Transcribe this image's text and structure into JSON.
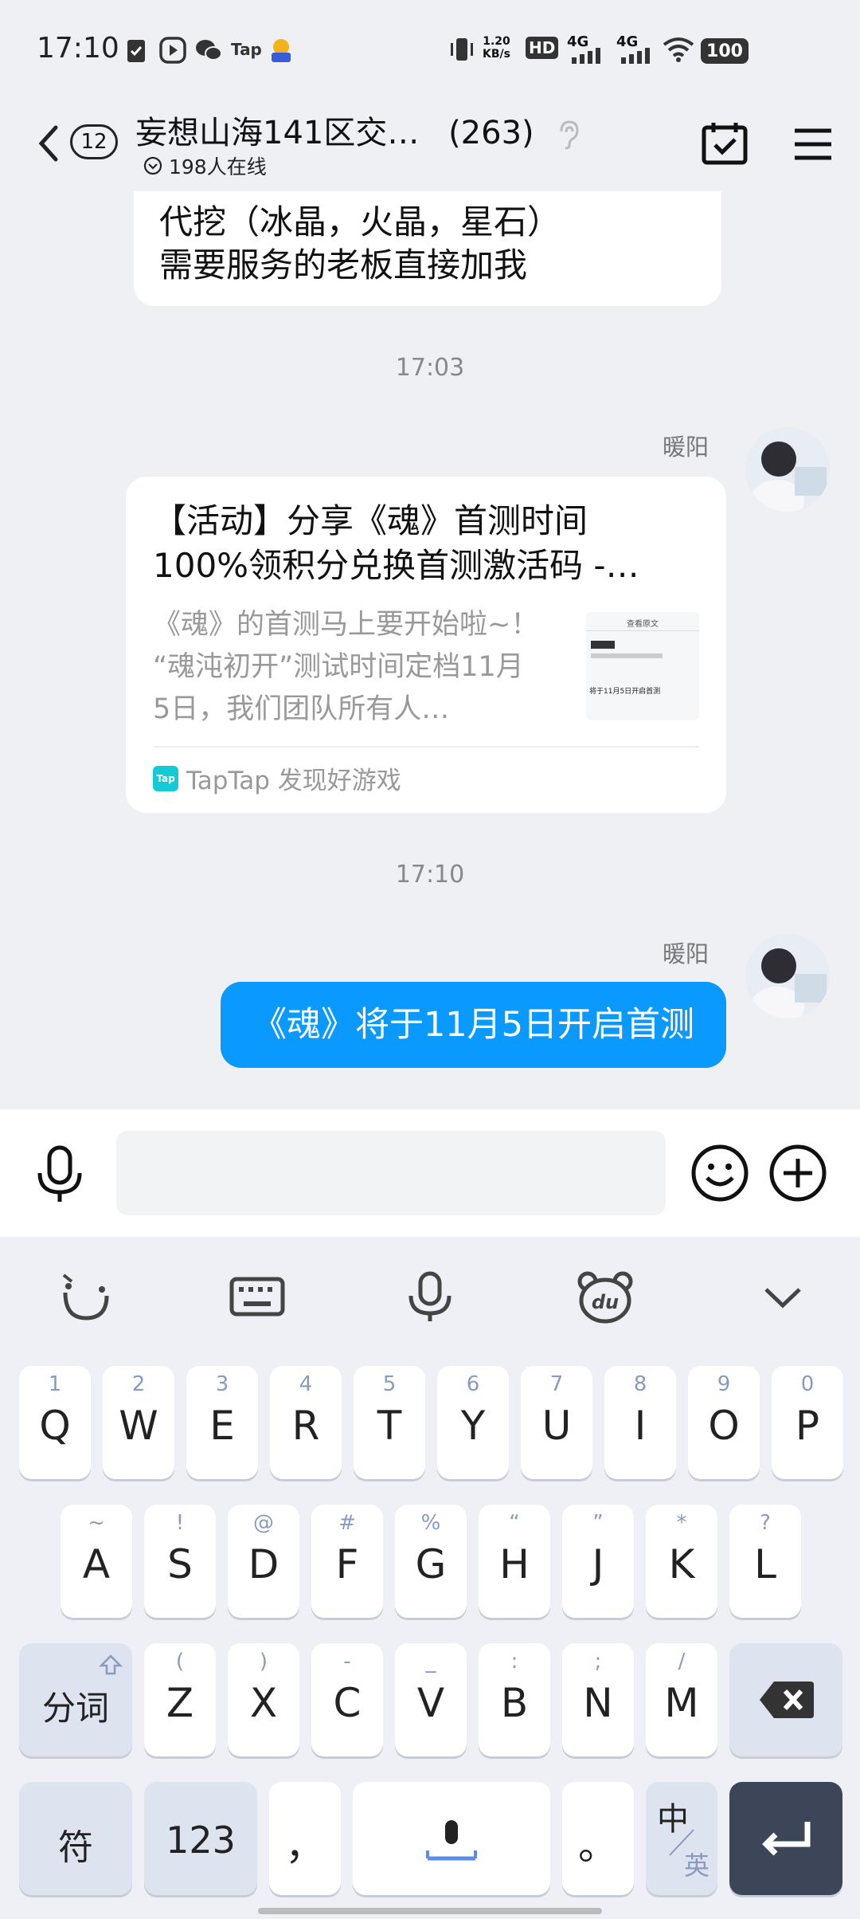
{
  "status_bar": {
    "time": "17:10",
    "net_speed_value": "1.20",
    "net_speed_unit": "KB/s",
    "hd_label": "HD",
    "signal_1": "4G",
    "signal_2": "4G",
    "battery": "100"
  },
  "header": {
    "unread_count": "12",
    "title": "妄想山海141区交…",
    "member_count": "(263)",
    "online": "198人在线"
  },
  "messages": [
    {
      "text_lines": [
        "代挖（冰晶，火晶，星石）",
        "需要服务的老板直接加我"
      ]
    },
    {
      "timestamp": "17:03",
      "sender": "暖阳",
      "card": {
        "title_line1": "【活动】分享《魂》首测时间",
        "title_line2": "100%领积分兑换首测激活码 -…",
        "desc_line1": "《魂》的首测马上要开始啦~！",
        "desc_line2": "“魂沌初开”测试时间定档11月",
        "desc_line3": "5日，我们团队所有人…",
        "thumb_header": "查看原文",
        "thumb_link": "将于11月5日开启首测",
        "source_logo": "Tap",
        "source": "TapTap 发现好游戏"
      }
    },
    {
      "timestamp": "17:10",
      "sender": "暖阳",
      "text": "《魂》将于11月5日开启首测"
    }
  ],
  "input": {
    "value": "",
    "placeholder": ""
  },
  "keyboard": {
    "row1": [
      {
        "hint": "1",
        "key": "Q"
      },
      {
        "hint": "2",
        "key": "W"
      },
      {
        "hint": "3",
        "key": "E"
      },
      {
        "hint": "4",
        "key": "R"
      },
      {
        "hint": "5",
        "key": "T"
      },
      {
        "hint": "6",
        "key": "Y"
      },
      {
        "hint": "7",
        "key": "U"
      },
      {
        "hint": "8",
        "key": "I"
      },
      {
        "hint": "9",
        "key": "O"
      },
      {
        "hint": "0",
        "key": "P"
      }
    ],
    "row2": [
      {
        "hint": "~",
        "key": "A"
      },
      {
        "hint": "!",
        "key": "S"
      },
      {
        "hint": "@",
        "key": "D"
      },
      {
        "hint": "#",
        "key": "F"
      },
      {
        "hint": "%",
        "key": "G"
      },
      {
        "hint": "“",
        "key": "H"
      },
      {
        "hint": "”",
        "key": "J"
      },
      {
        "hint": "*",
        "key": "K"
      },
      {
        "hint": "?",
        "key": "L"
      }
    ],
    "row3": [
      {
        "hint": "(",
        "key": "Z"
      },
      {
        "hint": ")",
        "key": "X"
      },
      {
        "hint": "-",
        "key": "C"
      },
      {
        "hint": "_",
        "key": "V"
      },
      {
        "hint": ":",
        "key": "B"
      },
      {
        "hint": ";",
        "key": "N"
      },
      {
        "hint": "/",
        "key": "M"
      }
    ],
    "segment_key": "分词",
    "symbol_key": "符",
    "number_key": "123",
    "comma_key": "，",
    "period_key": "。",
    "lang_key_main": "中",
    "lang_key_alt": "英"
  }
}
